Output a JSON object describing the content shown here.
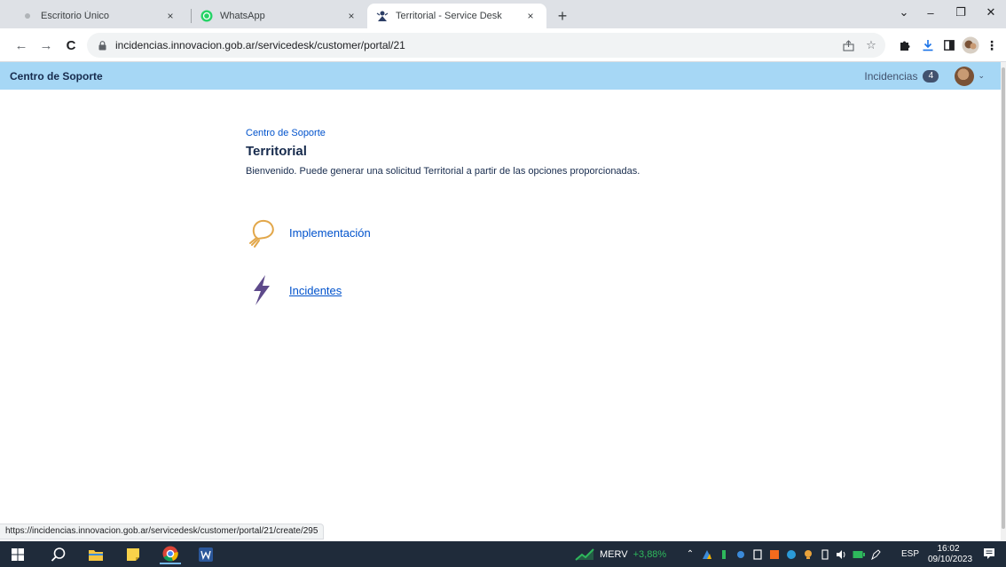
{
  "browser": {
    "tabs": [
      {
        "title": "Escritorio Único",
        "close": "×"
      },
      {
        "title": "WhatsApp",
        "close": "×"
      },
      {
        "title": "Territorial - Service Desk",
        "close": "×"
      }
    ],
    "new_tab": "+",
    "window_controls": {
      "expand": "⌄",
      "minimize": "–",
      "restore": "❐",
      "close": "✕"
    },
    "nav": {
      "back": "←",
      "forward": "→",
      "reload": "C"
    },
    "url": "incidencias.innovacion.gob.ar/servicedesk/customer/portal/21"
  },
  "portal": {
    "brand": "Centro de Soporte",
    "requests_label": "Incidencias",
    "requests_count": "4",
    "avatar_caret": "⌄"
  },
  "content": {
    "breadcrumb": "Centro de Soporte",
    "title": "Territorial",
    "welcome": "Bienvenido. Puede generar una solicitud Territorial a partir de las opciones proporcionadas.",
    "request_types": [
      {
        "label": "Implementación",
        "icon": "lightbulb-icon"
      },
      {
        "label": "Incidentes",
        "icon": "lightning-bolt-icon"
      }
    ]
  },
  "status_url": "https://incidencias.innovacion.gob.ar/servicedesk/customer/portal/21/create/295",
  "taskbar": {
    "stock_name": "MERV",
    "stock_change": "+3,88%",
    "language": "ESP",
    "time": "16:02",
    "date": "09/10/2023"
  },
  "colors": {
    "header_bg": "#a6d7f5",
    "link": "#0052cc",
    "text": "#172b4d",
    "lightbulb": "#e2a74a",
    "bolt": "#5e4a8b",
    "taskbar_bg": "#1f2b3a",
    "stock_up": "#2eb85c"
  }
}
